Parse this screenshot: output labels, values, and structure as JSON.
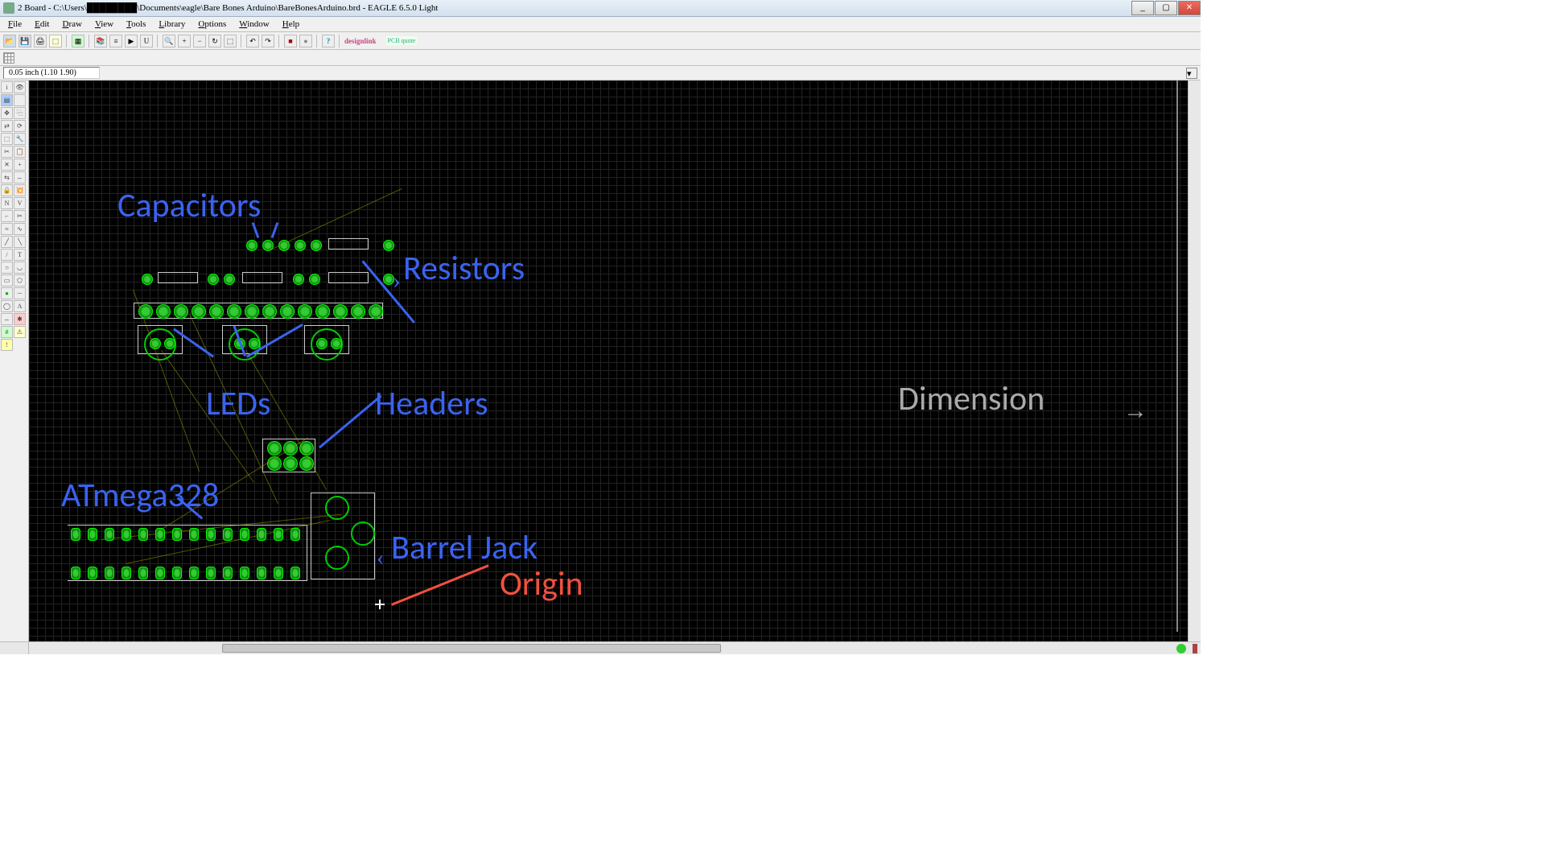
{
  "title": "2 Board - C:\\Users\\████████\\Documents\\eagle\\Bare Bones Arduino\\BareBonesArduino.brd - EAGLE 6.5.0 Light",
  "menu": {
    "file": "File",
    "edit": "Edit",
    "draw": "Draw",
    "view": "View",
    "tools": "Tools",
    "library": "Library",
    "options": "Options",
    "window": "Window",
    "help": "Help"
  },
  "coord": "0.05 inch (1.10 1.90)",
  "designlink": "designlink",
  "pcbquote": "PCB quote",
  "labels": {
    "capacitors": "Capacitors",
    "resistors": "Resistors",
    "leds": "LEDs",
    "headers": "Headers",
    "atmega": "ATmega328",
    "barrel": "Barrel Jack",
    "origin": "Origin",
    "dimension": "Dimension"
  },
  "icons": {
    "help": "?",
    "open": "📁",
    "save": "💾",
    "print": "🖨"
  }
}
